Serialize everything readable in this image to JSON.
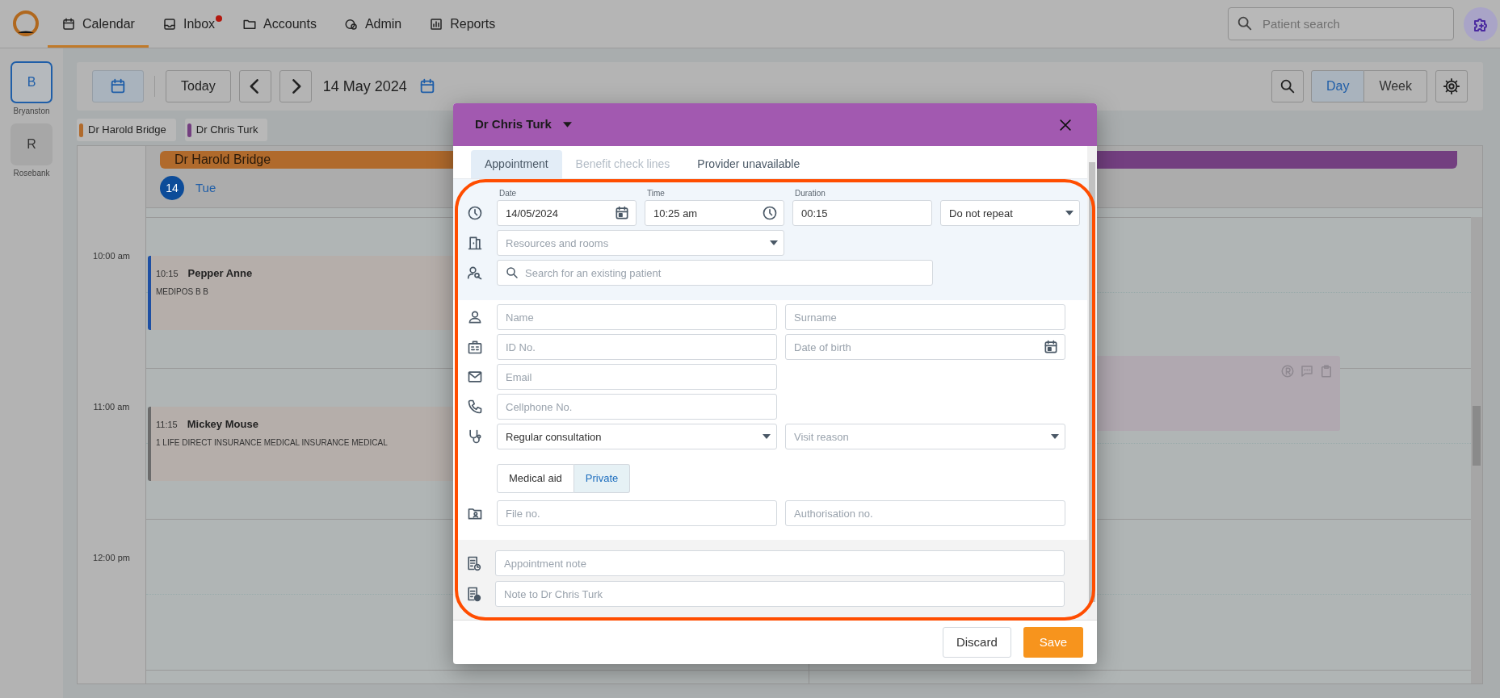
{
  "nav": {
    "items": [
      {
        "label": "Calendar",
        "selected": true,
        "badge": false
      },
      {
        "label": "Inbox",
        "selected": false,
        "badge": true
      },
      {
        "label": "Accounts",
        "selected": false,
        "badge": false
      },
      {
        "label": "Admin",
        "selected": false,
        "badge": false
      },
      {
        "label": "Reports",
        "selected": false,
        "badge": false
      }
    ],
    "search": {
      "placeholder": "Patient search"
    }
  },
  "sites": [
    {
      "initial": "B",
      "label": "Bryanston",
      "selected": true
    },
    {
      "initial": "R",
      "label": "Rosebank",
      "selected": false
    }
  ],
  "toolbar": {
    "today": "Today",
    "date": "14 May 2024",
    "views": [
      {
        "label": "Day",
        "selected": true
      },
      {
        "label": "Week",
        "selected": false
      }
    ]
  },
  "providers": [
    {
      "name": "Dr Harold Bridge",
      "color": "#b06a2c"
    },
    {
      "name": "Dr Chris Turk",
      "color": "#733f80"
    }
  ],
  "calendar": {
    "time_labels": [
      "10:00 am",
      "11:00 am",
      "12:00 pm"
    ],
    "columns": [
      {
        "provider": "Dr Harold Bridge",
        "color": "#b06a2c",
        "day_number": "14",
        "day_name": "Tue",
        "appointments": [
          {
            "time": "10:15",
            "name": "Pepper Anne",
            "detail": "MEDIPOS B B",
            "color": "#1e4fa3"
          },
          {
            "time": "11:15",
            "name": "Mickey Mouse",
            "detail": "1 LIFE DIRECT INSURANCE MEDICAL INSURANCE MEDICAL",
            "color": "#6b6b6b"
          }
        ]
      },
      {
        "color": "#733f80",
        "appointments": [
          {
            "color": "#b0a8b0"
          }
        ]
      }
    ]
  },
  "modal": {
    "provider": "Dr Chris Turk",
    "tabs": [
      {
        "label": "Appointment",
        "selected": true,
        "disabled": false
      },
      {
        "label": "Benefit check lines",
        "selected": false,
        "disabled": true
      },
      {
        "label": "Provider unavailable",
        "selected": false,
        "disabled": false
      }
    ],
    "date": {
      "label": "Date",
      "value": "14/05/2024"
    },
    "time": {
      "label": "Time",
      "value": "10:25 am"
    },
    "duration": {
      "label": "Duration",
      "value": "00:15"
    },
    "repeat": {
      "value": "Do not repeat"
    },
    "resources": {
      "placeholder": "Resources and rooms"
    },
    "patient_search": {
      "placeholder": "Search for an existing patient"
    },
    "name": {
      "placeholder": "Name"
    },
    "surname": {
      "placeholder": "Surname"
    },
    "id_no": {
      "placeholder": "ID No."
    },
    "date_of_birth": {
      "placeholder": "Date of birth"
    },
    "email": {
      "placeholder": "Email"
    },
    "cellphone": {
      "placeholder": "Cellphone No."
    },
    "consultation": {
      "value": "Regular consultation"
    },
    "visit_reason": {
      "placeholder": "Visit reason"
    },
    "billing": [
      {
        "label": "Medical aid",
        "selected": false
      },
      {
        "label": "Private",
        "selected": true
      }
    ],
    "file_no": {
      "placeholder": "File no."
    },
    "authorisation_no": {
      "placeholder": "Authorisation no."
    },
    "notes": [
      {
        "placeholder": "Appointment note"
      },
      {
        "placeholder": "Note to Dr Chris Turk"
      }
    ],
    "discard": "Discard",
    "save": "Save"
  }
}
